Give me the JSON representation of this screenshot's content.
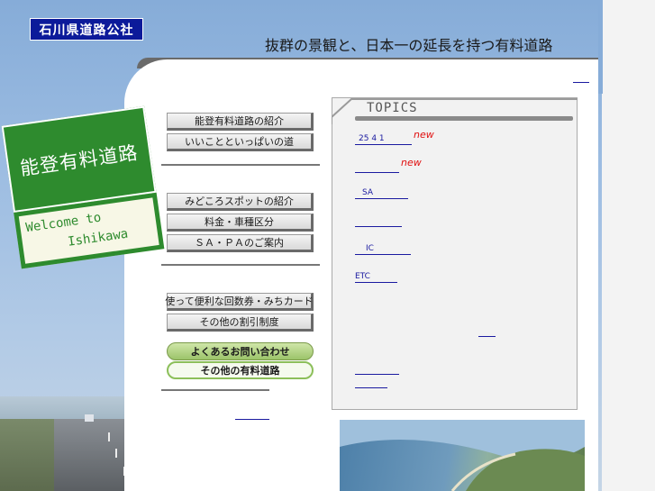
{
  "header": {
    "logo_text": "石川県道路公社",
    "tagline": "抜群の景観と、日本一の延長を持つ有料道路"
  },
  "sign": {
    "title": "能登有料道路",
    "welcome_line1": "Welcome to",
    "welcome_line2": "Ishikawa"
  },
  "nav": {
    "group1": [
      "能登有料道路の紹介",
      "いいことといっぱいの道"
    ],
    "group2": [
      "みどころスポットの紹介",
      "料金・車種区分",
      "ＳＡ・ＰＡのご案内"
    ],
    "group3": [
      "使って便利な回数券・みちカード",
      "その他の割引制度"
    ],
    "group4": [
      "よくあるお問い合わせ",
      "その他の有料道路"
    ]
  },
  "topics": {
    "header": "TOPICS",
    "items": [
      {
        "text": "25 4 1",
        "new": "new"
      },
      {
        "text": "",
        "new": "new"
      },
      {
        "text": "SA",
        "new": ""
      },
      {
        "text": "",
        "new": ""
      },
      {
        "text": "IC",
        "new": ""
      },
      {
        "text": "ETC",
        "new": ""
      }
    ]
  },
  "colors": {
    "logo_bg": "#0c1a9a",
    "sign_green": "#2e8b2e",
    "new_red": "#e01010",
    "link_blue": "#1a1aa0",
    "sky": "#9dbde2"
  }
}
